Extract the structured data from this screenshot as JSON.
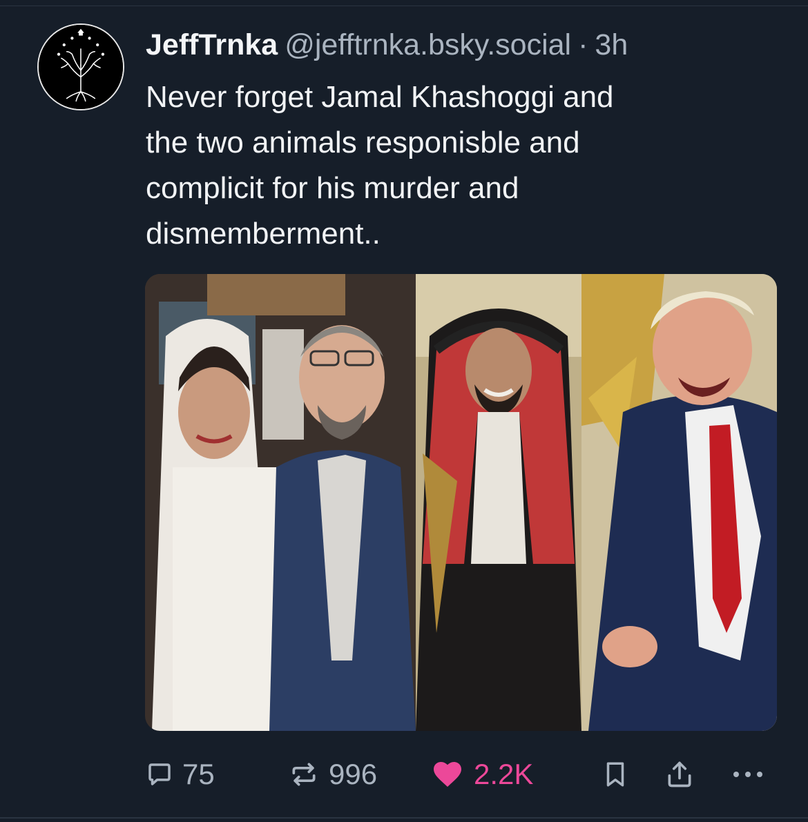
{
  "post": {
    "author_name": "JeffTrnka",
    "handle": "@jefftrnka.bsky.social",
    "separator": "·",
    "timestamp": "3h",
    "text": "Never forget Jamal Khashoggi and\nthe two animals responisble and\ncomplicit for his murder and\ndismemberment.."
  },
  "avatar": {
    "icon": "white-tree-icon"
  },
  "media": {
    "panels": [
      "photo-woman-and-man-in-suit",
      "photo-man-in-red-keffiyeh",
      "photo-man-laughing-red-tie"
    ]
  },
  "actions": {
    "reply_count": "75",
    "repost_count": "996",
    "like_count": "2.2K",
    "like_color": "#ec4899",
    "icons": [
      "reply-icon",
      "repost-icon",
      "heart-icon",
      "bookmark-icon",
      "share-icon",
      "more-icon"
    ]
  },
  "colors": {
    "background": "#161e29",
    "text": "#f1f3f5",
    "muted": "#aab4c0"
  }
}
